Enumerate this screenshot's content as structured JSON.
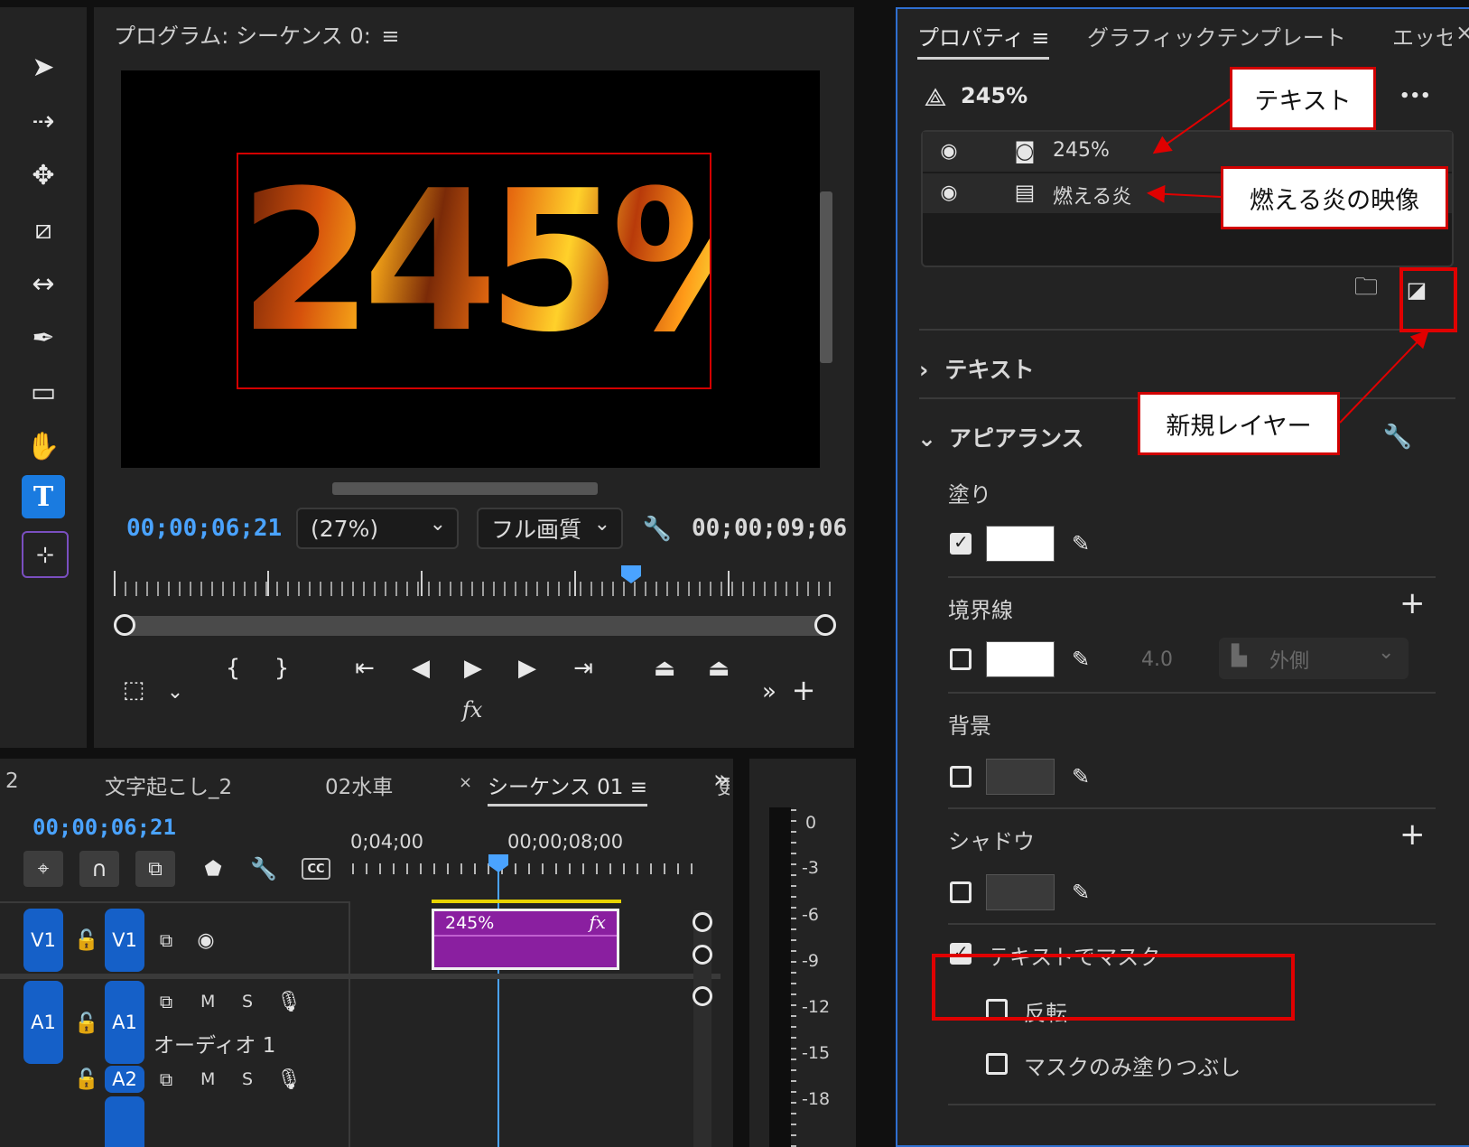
{
  "program_monitor": {
    "title": "プログラム: シーケンス 0:",
    "menu_icon": "hamburger-icon",
    "overlay_text": "245%",
    "current_timecode": "00;00;06;21",
    "zoom_value": "(27%)",
    "quality_value": "フル画質",
    "duration_timecode": "00;00;09;06",
    "fx_label": "fx"
  },
  "tools": [
    {
      "name": "selection-tool-icon",
      "glyph": "➤"
    },
    {
      "name": "track-select-tool-icon",
      "glyph": "⇢"
    },
    {
      "name": "ripple-edit-tool-icon",
      "glyph": "✥"
    },
    {
      "name": "razor-tool-icon",
      "glyph": "⧄"
    },
    {
      "name": "slip-tool-icon",
      "glyph": "↔"
    },
    {
      "name": "pen-tool-icon",
      "glyph": "✒"
    },
    {
      "name": "rectangle-tool-icon",
      "glyph": "▭"
    },
    {
      "name": "hand-tool-icon",
      "glyph": "✋"
    },
    {
      "name": "type-tool-icon",
      "glyph": "T"
    },
    {
      "name": "vertical-type-tool-icon",
      "glyph": "⊹"
    }
  ],
  "properties_panel": {
    "tabs": [
      "プロパティ",
      "グラフィックテンプレート",
      "エッセ"
    ],
    "close_glyph": "×",
    "object_name": "245%",
    "more_glyph": "•••",
    "layers": [
      {
        "name": "245%",
        "type_icon": "text-layer-icon"
      },
      {
        "name": "燃える炎",
        "type_icon": "video-layer-icon"
      }
    ],
    "sections": {
      "text": "テキスト",
      "appearance": "アピアランス"
    },
    "fill_label": "塗り",
    "stroke_label": "境界線",
    "stroke_width": "4.0",
    "stroke_position": "外側",
    "background_label": "背景",
    "shadow_label": "シャドウ",
    "mask_with_text": "テキストでマスク",
    "invert_label": "反転",
    "mask_fill_only": "マスクのみ塗りつぶし",
    "fill_checked": true,
    "mask_checked": true,
    "fill_color": "#ffffff",
    "stroke_color": "#ffffff"
  },
  "callouts": {
    "text": "テキスト",
    "flame_video": "燃える炎の映像",
    "new_layer": "新規レイヤー"
  },
  "timeline": {
    "tabs": [
      "2",
      "文字起こし_2",
      "02水車",
      "シーケンス 01",
      "更"
    ],
    "active_tab_close": "×",
    "more_tabs_glyph": "»",
    "timecode": "00;00;06;21",
    "ruler_labels": [
      "0;04;00",
      "00;00;08;00"
    ],
    "clip_label": "245%",
    "clip_fx": "fx",
    "tracks": {
      "v1_src": "V1",
      "v1_dst": "V1",
      "a1_src": "A1",
      "a1_dst": "A1",
      "a2": "A2",
      "audio_name": "オーディオ 1",
      "m": "M",
      "s": "S"
    },
    "cc_label": "CC"
  },
  "audio_meter": {
    "labels": [
      "0",
      "-3",
      "-6",
      "-9",
      "-12",
      "-15",
      "-18"
    ]
  },
  "colors": {
    "accent_blue": "#4aa3ff",
    "selection_red": "#e00000",
    "clip_purple": "#8a1fa0"
  }
}
